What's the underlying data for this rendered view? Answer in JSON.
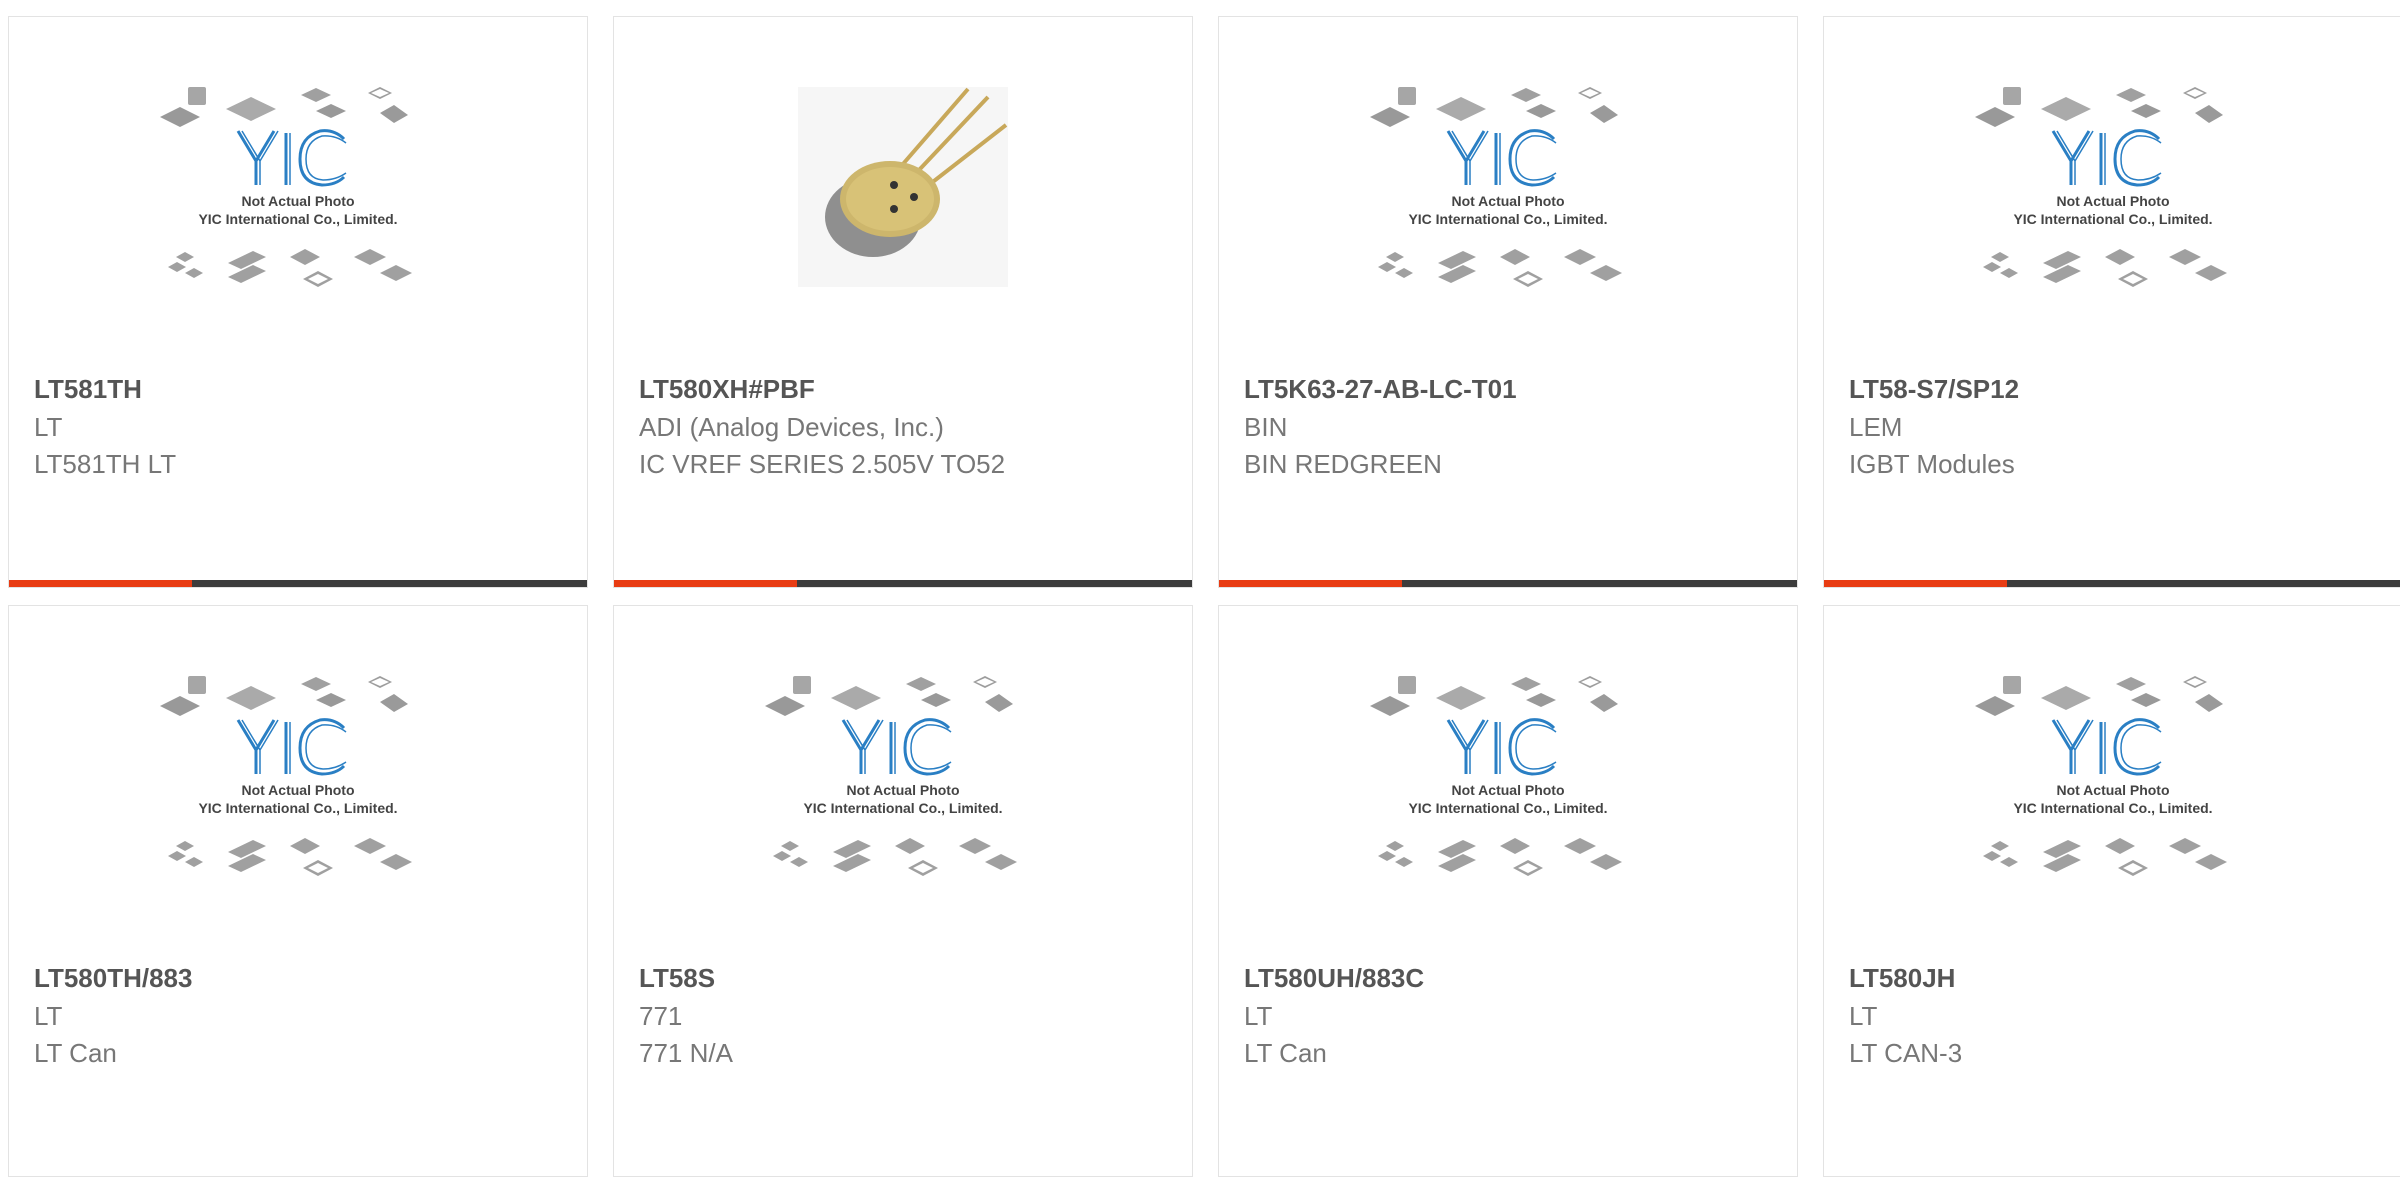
{
  "colors": {
    "accent": "#e83c13",
    "bar_dark": "#3c3c3c",
    "logo_blue": "#2a7fc4",
    "title": "#555555",
    "text": "#777777"
  },
  "placeholder": {
    "logo_text": "YIC",
    "line1": "Not Actual Photo",
    "line2": "YIC International Co., Limited."
  },
  "products": [
    {
      "part": "LT581TH",
      "manufacturer": "LT",
      "description": "LT581TH LT",
      "image": "placeholder"
    },
    {
      "part": "LT580XH#PBF",
      "manufacturer": "ADI (Analog Devices, Inc.)",
      "description": "IC VREF SERIES 2.505V TO52",
      "image": "to52-can-photo"
    },
    {
      "part": "LT5K63-27-AB-LC-T01",
      "manufacturer": "BIN",
      "description": "BIN REDGREEN",
      "image": "placeholder"
    },
    {
      "part": "LT58-S7/SP12",
      "manufacturer": "LEM",
      "description": "IGBT Modules",
      "image": "placeholder"
    },
    {
      "part": "LT580TH/883",
      "manufacturer": "LT",
      "description": "LT Can",
      "image": "placeholder"
    },
    {
      "part": "LT58S",
      "manufacturer": "771",
      "description": "771 N/A",
      "image": "placeholder"
    },
    {
      "part": "LT580UH/883C",
      "manufacturer": "LT",
      "description": "LT Can",
      "image": "placeholder"
    },
    {
      "part": "LT580JH",
      "manufacturer": "LT",
      "description": "LT CAN-3",
      "image": "placeholder"
    }
  ]
}
